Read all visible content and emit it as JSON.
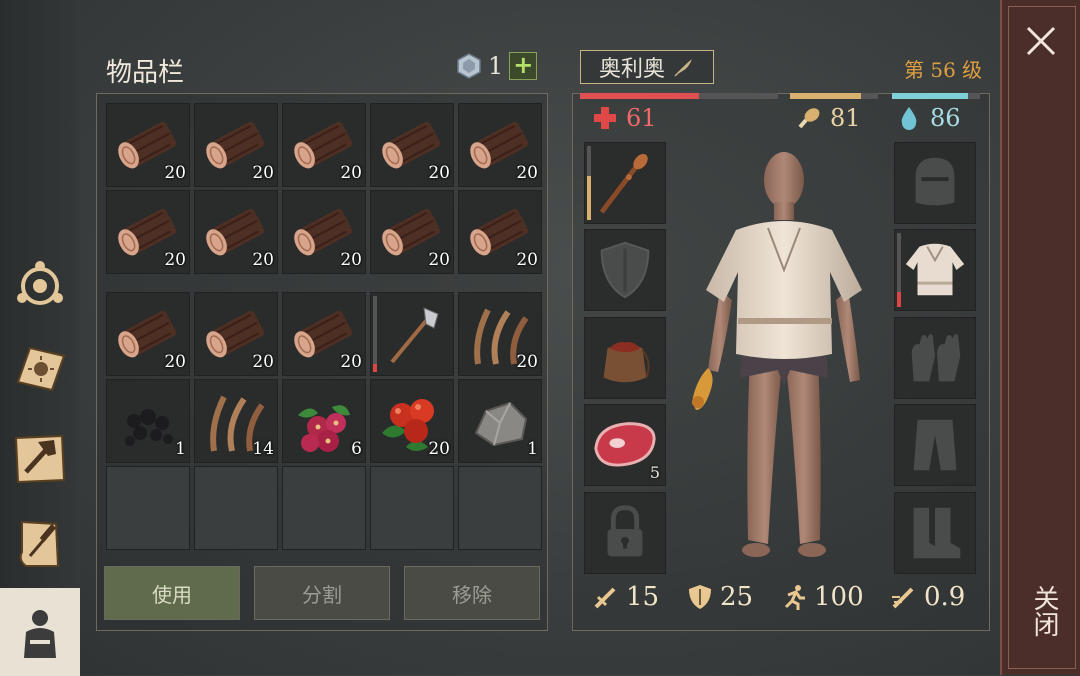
{
  "inventory": {
    "title": "物品栏",
    "gem_count": "1",
    "add_label": "+",
    "slots": [
      {
        "item": "log-icon",
        "count": "20"
      },
      {
        "item": "log-icon",
        "count": "20"
      },
      {
        "item": "log-icon",
        "count": "20"
      },
      {
        "item": "log-icon",
        "count": "20"
      },
      {
        "item": "log-icon",
        "count": "20"
      },
      {
        "item": "log-icon",
        "count": "20"
      },
      {
        "item": "log-icon",
        "count": "20"
      },
      {
        "item": "log-icon",
        "count": "20"
      },
      {
        "item": "log-icon",
        "count": "20"
      },
      {
        "item": "log-icon",
        "count": "20"
      },
      {
        "item": "log-icon",
        "count": "20"
      },
      {
        "item": "log-icon",
        "count": "20"
      },
      {
        "item": "log-icon",
        "count": "20"
      },
      {
        "item": "axe-icon",
        "count": "",
        "durability": 0.1
      },
      {
        "item": "fiber-icon",
        "count": "20"
      },
      {
        "item": "coal-icon",
        "count": "1"
      },
      {
        "item": "fiber-icon",
        "count": "14"
      },
      {
        "item": "berries-icon",
        "count": "6"
      },
      {
        "item": "apples-icon",
        "count": "20"
      },
      {
        "item": "stone-icon",
        "count": "1"
      },
      {
        "item": "empty",
        "count": ""
      },
      {
        "item": "empty",
        "count": ""
      },
      {
        "item": "empty",
        "count": ""
      },
      {
        "item": "empty",
        "count": ""
      },
      {
        "item": "empty",
        "count": ""
      }
    ],
    "buttons": {
      "use": "使用",
      "split": "分割",
      "remove": "移除"
    }
  },
  "character": {
    "name": "奥利奥",
    "level": "第 56 级",
    "health": {
      "value": "61",
      "fraction": 0.6,
      "color": "#e05050"
    },
    "hunger": {
      "value": "81",
      "fraction": 0.81,
      "color": "#d8b070"
    },
    "thirst": {
      "value": "86",
      "fraction": 0.86,
      "color": "#80d0d8"
    },
    "left_slots": [
      {
        "item": "club-icon",
        "count": "",
        "durability": 0.6
      },
      {
        "item": "shield-icon",
        "count": ""
      },
      {
        "item": "bag-icon",
        "count": ""
      },
      {
        "item": "meat-icon",
        "count": "5"
      },
      {
        "item": "lock-icon",
        "count": ""
      }
    ],
    "right_slots": [
      {
        "item": "helmet-icon",
        "count": ""
      },
      {
        "item": "shirt-icon",
        "count": "",
        "durability": 0.2
      },
      {
        "item": "gloves-icon",
        "count": ""
      },
      {
        "item": "pants-icon",
        "count": ""
      },
      {
        "item": "boots-icon",
        "count": ""
      }
    ],
    "stats": {
      "attack": "15",
      "defense": "25",
      "speed": "100",
      "attack_speed": "0.9"
    }
  },
  "close": {
    "label": "关闭"
  }
}
